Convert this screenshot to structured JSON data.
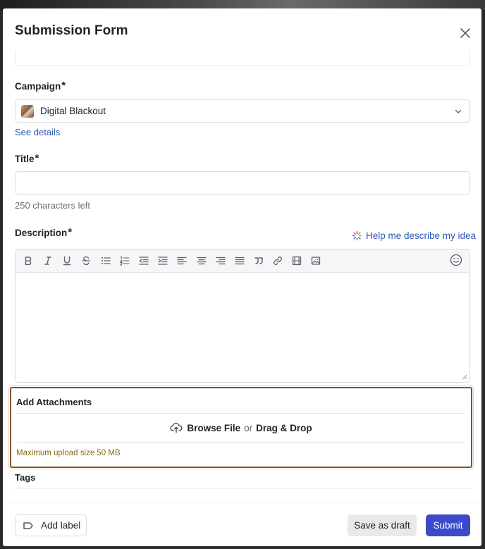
{
  "modal": {
    "title": "Submission Form"
  },
  "campaign": {
    "label": "Campaign",
    "required_mark": "*",
    "selected_value": "Digital Blackout",
    "details_link": "See details"
  },
  "title_field": {
    "label": "Title",
    "required_mark": "*",
    "value": "",
    "hint": "250 characters left"
  },
  "description": {
    "label": "Description",
    "required_mark": "*",
    "help_link": "Help me describe my idea",
    "toolbar": [
      "bold-icon",
      "italic-icon",
      "underline-icon",
      "strikethrough-icon",
      "bullet-list-icon",
      "numbered-list-icon",
      "outdent-icon",
      "indent-icon",
      "align-left-icon",
      "align-center-icon",
      "align-right-icon",
      "justify-icon",
      "quote-icon",
      "link-icon",
      "video-icon",
      "image-icon"
    ],
    "emoji": "emoji-icon"
  },
  "attachments": {
    "title": "Add Attachments",
    "browse": "Browse File",
    "or": "or",
    "drag": "Drag & Drop",
    "max_size_hint": "Maximum upload size 50 MB"
  },
  "tags": {
    "label": "Tags"
  },
  "footer": {
    "add_label": "Add label",
    "save_draft": "Save as draft",
    "submit": "Submit"
  },
  "colors": {
    "accent": "#3b4bc8",
    "link": "#2f58b6",
    "highlight_border": "#7a5a1e",
    "hint_gold": "#8a6a12"
  }
}
